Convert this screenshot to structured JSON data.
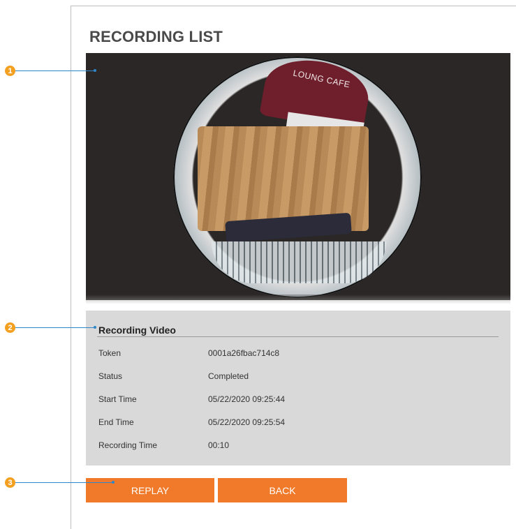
{
  "page": {
    "title": "RECORDING LIST"
  },
  "video": {
    "sign_text": "LOUNG CAFE"
  },
  "recording_video": {
    "title": "Recording Video",
    "rows": [
      {
        "label": "Token",
        "value": "0001a26fbac714c8"
      },
      {
        "label": "Status",
        "value": "Completed"
      },
      {
        "label": "Start Time",
        "value": "05/22/2020 09:25:44"
      },
      {
        "label": "End Time",
        "value": "05/22/2020 09:25:54"
      },
      {
        "label": "Recording Time",
        "value": "00:10"
      }
    ]
  },
  "buttons": {
    "replay": "REPLAY",
    "back": "BACK"
  },
  "callouts": [
    {
      "number": "1"
    },
    {
      "number": "2"
    },
    {
      "number": "3"
    }
  ],
  "colors": {
    "accent_button": "#f07a2a",
    "callout_blue": "#2f86c8",
    "callout_badge": "#f3a020"
  }
}
